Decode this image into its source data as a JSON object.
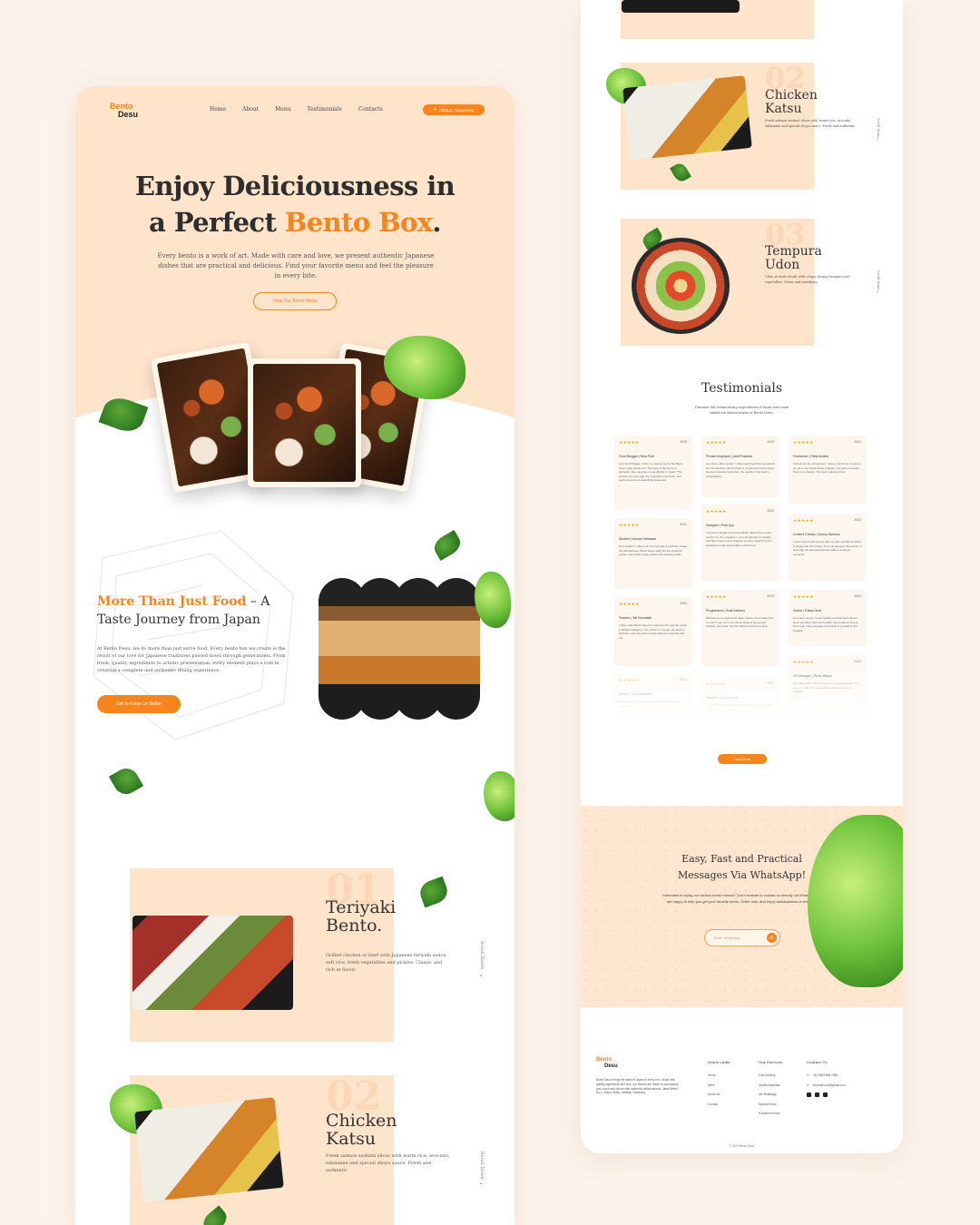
{
  "brand": {
    "line1": "Bento",
    "line2": "Desu"
  },
  "nav": {
    "items": [
      "Home",
      "About",
      "Menu",
      "Testimonials",
      "Contacts"
    ],
    "location": "Cikupa, Tangerang"
  },
  "hero": {
    "title_line1": "Enjoy Deliciousness in",
    "title_line2_pre": "a Perfect ",
    "title_line2_accent": "Bento Box",
    "title_line2_post": ".",
    "description": "Every bento is a work of art. Made with care and love, we present authentic Japanese dishes that are practical and delicious. Find your favorite menu and feel the pleasure in every bite.",
    "button": "View Our Bento Menu"
  },
  "about": {
    "title_accent": "More Than Just Food",
    "title_rest_1": " – A",
    "title_line2": "Taste Journey from Japan",
    "description": "At Bento Desu, we do more than just serve food. Every bento box we create is the result of our love for Japanese traditions passed down through generations. From fresh, quality ingredients to artistic presentation, every element plays a role in creating a complete and authentic dining experience.",
    "button": "Get to Know Us Better"
  },
  "menu": {
    "scroll_label": "Scroll Down",
    "items": [
      {
        "num": "01",
        "name_line1": "Teriyaki",
        "name_line2": "Bento.",
        "desc": "Grilled chicken or beef with Japanese teriyaki sauce, soft rice, fresh vegetables and pickles. Classic and rich in flavor."
      },
      {
        "num": "02",
        "name_line1": "Chicken",
        "name_line2": "Katsu",
        "desc": "Fresh salmon sashimi slices with warm rice, avocado, edamame and special shoyu sauce. Fresh and authentic"
      },
      {
        "num": "03",
        "name_line1": "Tempura",
        "name_line2": "Udon",
        "desc": "Udon in dashi broth with crispy shrimp tempura and vegetables. Warm and satisfying."
      }
    ]
  },
  "testimonials": {
    "title": "Testimonials",
    "subtitle": "Discover the extraordinary experiences of those who have tasted the deliciousness of Bento Desu.",
    "load_more": "Load More",
    "cards": [
      {
        "stars": "★★★★★",
        "year": "2023",
        "name": "Food Blogger | Rina Putri",
        "text": "As a food blogger, I often try various foods, but Bento Desu really stands out. The taste of the bento is authentic, like enjoying a meal directly in Japan. The portions are just right, the ingredients are fresh, and each bento box is beautifully presented."
      },
      {
        "stars": "★★★★★",
        "year": "2022",
        "name": "Private employee | Andi Pratama",
        "text": "As a busy office worker, I often need food that is practical but still delicious. Bento Desu is my favorite lunch choice because besides being fast, the quality of the food is extraordinary."
      },
      {
        "stars": "★★★★★",
        "year": "2021",
        "name": "Freelancer | Fitria Amalia",
        "text": "Sometimes as a freelancer, I have a hard time to cook or go out to eat. Bento Desu is always my savior because there is no hassle. The food is always fresh."
      },
      {
        "stars": "★★★★★",
        "year": "2021",
        "name": "Student | Ahmad Setiawan",
        "text": "As a student, I often look for food that is practical, cheap, but still delicious. Bento Desu really fits the student's pocket, with a fairly large portion and delicious taste."
      },
      {
        "stars": "★★★★★",
        "year": "2023",
        "name": "Designer | Putri Ayu",
        "text": "In terms of design and presentation, Bento Desu really stands out. As a designer, I love its attention to details, and Bento Desu pays attention to every detail from the packaging to the presentation of the food."
      },
      {
        "stars": "★★★★★",
        "year": "2022",
        "name": "Content Creator | Doony Santoso",
        "text": "I often have hectic shoots with my team and Bento Desu is always the first choice. Not only because the portion is quite big, but also because the taste is loved by everyone."
      },
      {
        "stars": "★★★★★",
        "year": "2022",
        "name": "Teacher | Siti Nurmalah",
        "text": "I often order Bento Desu for school lunch, and the result is always satisfying. The portion is enough, the taste is delicious, and the price is reasonable for a teacher like me."
      },
      {
        "stars": "★★★★★",
        "year": "2023",
        "name": "Programmer | Budi Santoso",
        "text": "Working as a programmer often means I don't have time to cook or go out to eat. Bento Desu is the perfect solution, just order, and the delivery arrives on time."
      },
      {
        "stars": "★★★★★",
        "year": "2022",
        "name": "Doctor | Ratna Dewi",
        "text": "As a busy doctor, I need healthy and fast food. Bento Desu provides fresh and healthy menu options. Every time I eat, I feel energetic and ready to go back to the hospital."
      },
      {
        "stars": "★★★★★",
        "year": "2023",
        "name": "HR Manager | Ricky Wijaya",
        "text": "Our office orders Bento Desu for company events. It is easy to order in large quantities and everyone is satisfied."
      },
      {
        "stars": "★★★★★",
        "year": "2021",
        "name": "Mother | Tiara Maharani",
        "text": "Bento Desu offers an authentic Japanese culinary experience."
      },
      {
        "stars": "★★★★★",
        "year": "2023",
        "name": "Traveller | Lia Kusuma",
        "text": "As a photographer, I feel that their food not only tastes good but is also beautiful."
      }
    ]
  },
  "whatsapp": {
    "title_line1": "Easy, Fast and Practical",
    "title_line2": "Messages Via WhatsApp!",
    "description": "Interested in trying our various bento menus? Don't hesitate to contact us directly via WhatsApp! We are happy to help you get your favorite bento. Order now, and enjoy deliciousness in every bite!",
    "placeholder": "Enter Whatsapp"
  },
  "footer": {
    "about": "Bento Desu brings the taste of Japan to every box. Made with quality ingredients and love, our bentos are made to accompany your lunch and dinner with authentic deliciousness. Jalan Bento No.1, Tokyo Street, Jakarta, Indonesia.",
    "quick_links_title": "Quick Links",
    "quick_links": [
      "Home",
      "Menu",
      "About Us",
      "Contact"
    ],
    "services_title": "Our Services",
    "services": [
      "Fast Delivery",
      "Quality Materials",
      "via WhatsApp",
      "Special Event",
      "Exclusive Promo"
    ],
    "contact_title": "Contact Us",
    "phone": "+62 8953 866 7880",
    "email": "bentodesu.id@gmail.com",
    "copyright": "© 2024 Bento Desu"
  },
  "colors": {
    "accent": "#f7841c",
    "peach": "#ffe4cc",
    "background": "#fbf3ec"
  }
}
